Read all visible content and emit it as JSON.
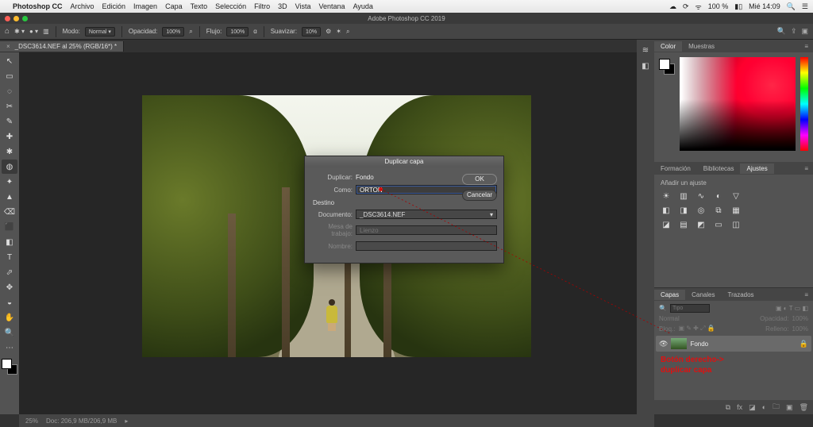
{
  "mac_menu": {
    "app": "Photoshop CC",
    "items": [
      "Archivo",
      "Edición",
      "Imagen",
      "Capa",
      "Texto",
      "Selección",
      "Filtro",
      "3D",
      "Vista",
      "Ventana",
      "Ayuda"
    ],
    "battery": "100 %",
    "clock": "Mié 14:09"
  },
  "titlebar": {
    "title": "Adobe Photoshop CC 2019"
  },
  "options": {
    "mode_label": "Modo:",
    "mode_value": "Normal",
    "opacity_label": "Opacidad:",
    "opacity_value": "100%",
    "flow_label": "Flujo:",
    "flow_value": "100%",
    "smooth_label": "Suavizar:",
    "smooth_value": "10%"
  },
  "doc_tab": {
    "label": "_DSC3614.NEF al 25% (RGB/16*) *"
  },
  "tools": [
    "↖",
    "▭",
    "◌",
    "✂",
    "✎",
    "✚",
    "✱",
    "◍",
    "✦",
    "▲",
    "⌫",
    "⬛",
    "◧",
    "T",
    "⬀",
    "✥",
    "◒",
    "✋",
    "🔍",
    "⋯"
  ],
  "status": {
    "zoom": "25%",
    "docinfo": "Doc: 206,9 MB/206,9 MB"
  },
  "color_panel": {
    "tabs": [
      "Color",
      "Muestras"
    ]
  },
  "mid_panel": {
    "tabs": [
      "Formación",
      "Bibliotecas",
      "Ajustes"
    ],
    "hint": "Añadir un ajuste"
  },
  "layers_panel": {
    "tabs": [
      "Capas",
      "Canales",
      "Trazados"
    ],
    "search_placeholder": "Tipo",
    "blend": "Normal",
    "opacity_label": "Opacidad:",
    "opacity_value": "100%",
    "lock_label": "Bloq.:",
    "fill_label": "Relleno:",
    "fill_value": "100%",
    "layer_name": "Fondo",
    "annotation_l1": "Botón derecho->",
    "annotation_l2": "duplicar capa"
  },
  "dialog": {
    "title": "Duplicar capa",
    "duplicate_label": "Duplicar:",
    "duplicate_value": "Fondo",
    "as_label": "Como:",
    "as_value": "ORTON",
    "dest_section": "Destino",
    "document_label": "Documento:",
    "document_value": "_DSC3614.NEF",
    "artboard_label": "Mesa de trabajo:",
    "artboard_value": "Lienzo",
    "name_label": "Nombre:",
    "ok": "OK",
    "cancel": "Cancelar"
  }
}
